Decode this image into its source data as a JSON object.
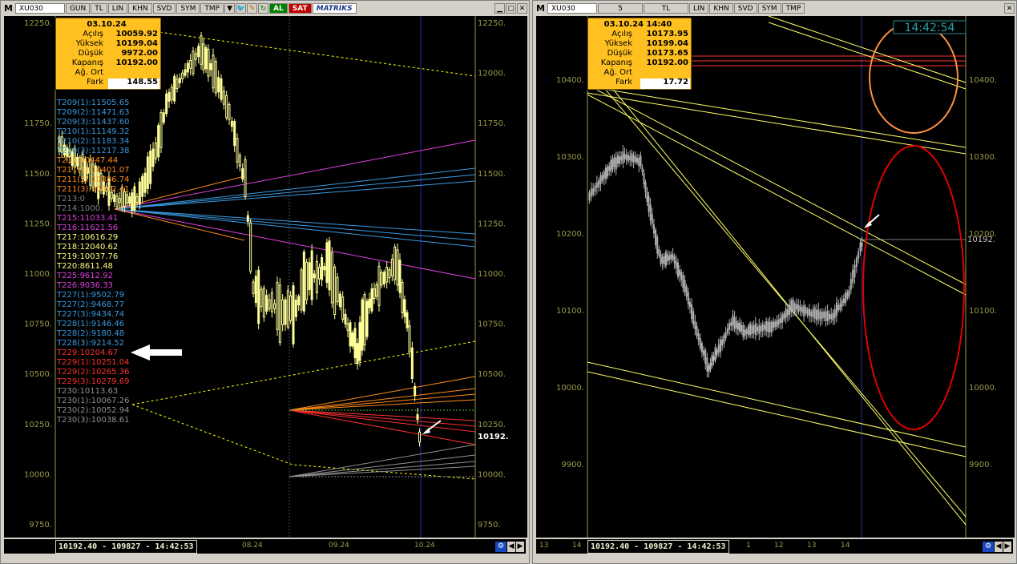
{
  "left": {
    "toolbar": {
      "symbol": "XU030",
      "period": "GUN",
      "currency": "TL",
      "scale": "LIN",
      "b1": "KHN",
      "b2": "SVD",
      "b3": "SYM",
      "b4": "TMP",
      "buy": "AL",
      "sell": "SAT",
      "brand": "MATRIKS"
    },
    "info": {
      "date": "03.10.24",
      "rows": [
        [
          "Açılış",
          "10059.92"
        ],
        [
          "Yüksek",
          "10199.04"
        ],
        [
          "Düşük",
          "9972.00"
        ],
        [
          "Kapanış",
          "10192.00"
        ],
        [
          "Ağ. Ort",
          ""
        ],
        [
          "Fark",
          "148.55"
        ]
      ]
    },
    "levels": [
      {
        "t": "T209(1):11505.65",
        "c": "#3a9ae0"
      },
      {
        "t": "T209(2):11471.63",
        "c": "#3a9ae0"
      },
      {
        "t": "T209(3):11437.60",
        "c": "#3a9ae0"
      },
      {
        "t": "T210(1):11149.32",
        "c": "#3a9ae0"
      },
      {
        "t": "T210(2):11183.34",
        "c": "#3a9ae0"
      },
      {
        "t": "T210(3):11217.38",
        "c": "#3a9ae0"
      },
      {
        "t": "T211:10447.44",
        "c": "#ff8c1a"
      },
      {
        "t": "T211(1):10401.07",
        "c": "#ff8c1a"
      },
      {
        "t": "T211(2):10386.74",
        "c": "#ff8c1a"
      },
      {
        "t": "T211(3):10372.41",
        "c": "#ff8c1a"
      },
      {
        "t": "T213:0",
        "c": "#808080"
      },
      {
        "t": "T214:1000.",
        "c": "#808080"
      },
      {
        "t": "T215:11033.41",
        "c": "#e040e0"
      },
      {
        "t": "T216:11621.56",
        "c": "#e040e0"
      },
      {
        "t": "T217:10616.29",
        "c": "#ffff80"
      },
      {
        "t": "T218:12040.62",
        "c": "#ffff80"
      },
      {
        "t": "T219:10037.76",
        "c": "#ffff80"
      },
      {
        "t": "T220:8611.48",
        "c": "#ffff80"
      },
      {
        "t": "T225:9612.92",
        "c": "#e040e0"
      },
      {
        "t": "T226:9036.33",
        "c": "#e040e0"
      },
      {
        "t": "T227(1):9502.79",
        "c": "#3a9ae0"
      },
      {
        "t": "T227(2):9468.77",
        "c": "#3a9ae0"
      },
      {
        "t": "T227(3):9434.74",
        "c": "#3a9ae0"
      },
      {
        "t": "T228(1):9146.46",
        "c": "#3a9ae0"
      },
      {
        "t": "T228(2):9180.48",
        "c": "#3a9ae0"
      },
      {
        "t": "T228(3):9214.52",
        "c": "#3a9ae0"
      },
      {
        "t": "T229:10204.67",
        "c": "#ff3030"
      },
      {
        "t": "T229(1):10251.04",
        "c": "#ff3030"
      },
      {
        "t": "T229(2):10265.36",
        "c": "#ff3030"
      },
      {
        "t": "T229(3):10279.69",
        "c": "#ff3030"
      },
      {
        "t": "T230:10113.63",
        "c": "#909090"
      },
      {
        "t": "T230(1):10067.26",
        "c": "#909090"
      },
      {
        "t": "T230(2):10052.94",
        "c": "#909090"
      },
      {
        "t": "T230(3):10038.61",
        "c": "#909090"
      }
    ],
    "price_ticks": [
      "12250.",
      "12000.",
      "11750.",
      "11500.",
      "11250.",
      "11000.",
      "10750.",
      "10500.",
      "10250.",
      "10000.",
      "9750."
    ],
    "last_price": "10192.",
    "x_ticks": [
      "08.24",
      "09.24",
      "10.24"
    ],
    "status": "10192.40 - 109827 - 14:42:53"
  },
  "right": {
    "toolbar": {
      "symbol": "XU030",
      "period": "5",
      "currency": "TL",
      "scale": "LIN",
      "b1": "KHN",
      "b2": "SVD",
      "b3": "SYM",
      "b4": "TMP"
    },
    "info": {
      "date": "03.10.24 14:40",
      "rows": [
        [
          "Açılış",
          "10173.95"
        ],
        [
          "Yüksek",
          "10199.04"
        ],
        [
          "Düşük",
          "10173.65"
        ],
        [
          "Kapanış",
          "10192.00"
        ],
        [
          "Ağ. Ort",
          ""
        ],
        [
          "Fark",
          "17.72"
        ]
      ]
    },
    "clock": "14:42:54",
    "price_ticks": [
      "10400.",
      "10300.",
      "10200.",
      "10100.",
      "10000.",
      "9900."
    ],
    "last_price": "10192.",
    "x_ticks": [
      "13",
      "14",
      "1",
      "12",
      "13",
      "14"
    ],
    "status": "10192.40 - 109827 - 14:42:53"
  },
  "colors": {
    "chart_bg": "#000000",
    "candle": "#ffff99",
    "info_bg": "#ffc020",
    "axis_text": "#9a9a4a"
  }
}
